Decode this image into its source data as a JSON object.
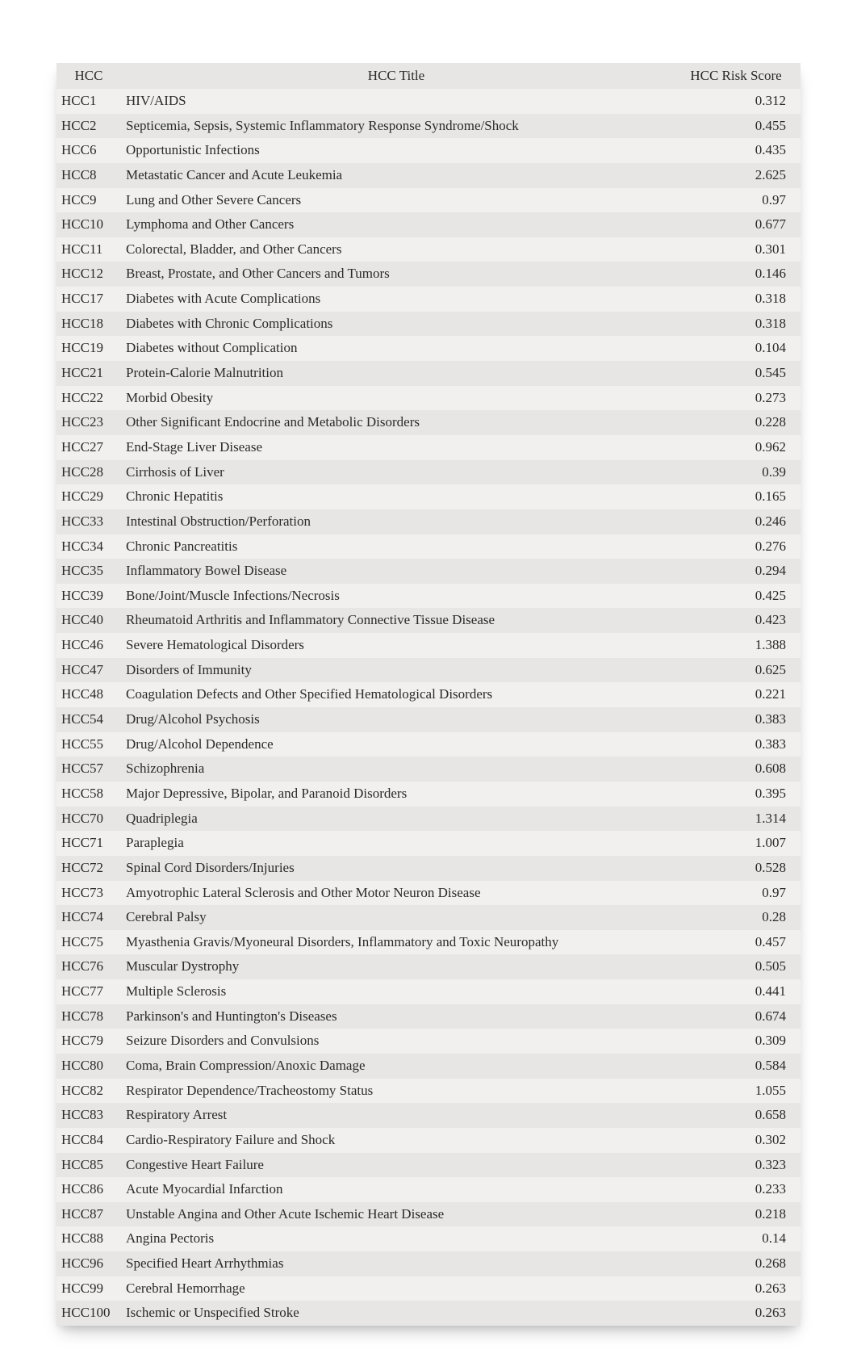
{
  "headers": {
    "hcc": "HCC",
    "title": "HCC Title",
    "score": "HCC Risk Score"
  },
  "rows": [
    {
      "hcc": "HCC1",
      "title": "HIV/AIDS",
      "score": "0.312"
    },
    {
      "hcc": "HCC2",
      "title": "Septicemia, Sepsis, Systemic Inflammatory Response Syndrome/Shock",
      "score": "0.455"
    },
    {
      "hcc": "HCC6",
      "title": "Opportunistic Infections",
      "score": "0.435"
    },
    {
      "hcc": "HCC8",
      "title": "Metastatic Cancer and Acute Leukemia",
      "score": "2.625"
    },
    {
      "hcc": "HCC9",
      "title": "Lung and Other Severe Cancers",
      "score": "0.97"
    },
    {
      "hcc": "HCC10",
      "title": "Lymphoma and Other Cancers",
      "score": "0.677"
    },
    {
      "hcc": "HCC11",
      "title": "Colorectal, Bladder, and Other Cancers",
      "score": "0.301"
    },
    {
      "hcc": "HCC12",
      "title": "Breast, Prostate, and Other Cancers and Tumors",
      "score": "0.146"
    },
    {
      "hcc": "HCC17",
      "title": "Diabetes with Acute Complications",
      "score": "0.318"
    },
    {
      "hcc": "HCC18",
      "title": "Diabetes with Chronic Complications",
      "score": "0.318"
    },
    {
      "hcc": "HCC19",
      "title": "Diabetes without Complication",
      "score": "0.104"
    },
    {
      "hcc": "HCC21",
      "title": "Protein-Calorie Malnutrition",
      "score": "0.545"
    },
    {
      "hcc": "HCC22",
      "title": "Morbid Obesity",
      "score": "0.273"
    },
    {
      "hcc": "HCC23",
      "title": "Other Significant Endocrine and Metabolic Disorders",
      "score": "0.228"
    },
    {
      "hcc": "HCC27",
      "title": "End-Stage Liver Disease",
      "score": "0.962"
    },
    {
      "hcc": "HCC28",
      "title": "Cirrhosis of Liver",
      "score": "0.39"
    },
    {
      "hcc": "HCC29",
      "title": "Chronic Hepatitis",
      "score": "0.165"
    },
    {
      "hcc": "HCC33",
      "title": "Intestinal Obstruction/Perforation",
      "score": "0.246"
    },
    {
      "hcc": "HCC34",
      "title": "Chronic Pancreatitis",
      "score": "0.276"
    },
    {
      "hcc": "HCC35",
      "title": "Inflammatory Bowel Disease",
      "score": "0.294"
    },
    {
      "hcc": "HCC39",
      "title": "Bone/Joint/Muscle Infections/Necrosis",
      "score": "0.425"
    },
    {
      "hcc": "HCC40",
      "title": "Rheumatoid Arthritis and Inflammatory Connective Tissue Disease",
      "score": "0.423"
    },
    {
      "hcc": "HCC46",
      "title": "Severe Hematological Disorders",
      "score": "1.388"
    },
    {
      "hcc": "HCC47",
      "title": "Disorders of Immunity",
      "score": "0.625"
    },
    {
      "hcc": "HCC48",
      "title": "Coagulation Defects and Other Specified Hematological Disorders",
      "score": "0.221"
    },
    {
      "hcc": "HCC54",
      "title": "Drug/Alcohol Psychosis",
      "score": "0.383"
    },
    {
      "hcc": "HCC55",
      "title": "Drug/Alcohol Dependence",
      "score": "0.383"
    },
    {
      "hcc": "HCC57",
      "title": "Schizophrenia",
      "score": "0.608"
    },
    {
      "hcc": "HCC58",
      "title": "Major Depressive, Bipolar, and Paranoid Disorders",
      "score": "0.395"
    },
    {
      "hcc": "HCC70",
      "title": "Quadriplegia",
      "score": "1.314"
    },
    {
      "hcc": "HCC71",
      "title": "Paraplegia",
      "score": "1.007"
    },
    {
      "hcc": "HCC72",
      "title": "Spinal Cord Disorders/Injuries",
      "score": "0.528"
    },
    {
      "hcc": "HCC73",
      "title": "Amyotrophic Lateral Sclerosis and Other Motor Neuron Disease",
      "score": "0.97"
    },
    {
      "hcc": "HCC74",
      "title": "Cerebral Palsy",
      "score": "0.28"
    },
    {
      "hcc": "HCC75",
      "title": "Myasthenia Gravis/Myoneural Disorders,  Inflammatory and Toxic Neuropathy",
      "score": "0.457"
    },
    {
      "hcc": "HCC76",
      "title": "Muscular Dystrophy",
      "score": "0.505"
    },
    {
      "hcc": "HCC77",
      "title": "Multiple Sclerosis",
      "score": "0.441"
    },
    {
      "hcc": "HCC78",
      "title": "Parkinson's and Huntington's Diseases",
      "score": "0.674"
    },
    {
      "hcc": "HCC79",
      "title": "Seizure Disorders and Convulsions",
      "score": "0.309"
    },
    {
      "hcc": "HCC80",
      "title": "Coma, Brain Compression/Anoxic Damage",
      "score": "0.584"
    },
    {
      "hcc": "HCC82",
      "title": "Respirator Dependence/Tracheostomy Status",
      "score": "1.055"
    },
    {
      "hcc": "HCC83",
      "title": "Respiratory Arrest",
      "score": "0.658"
    },
    {
      "hcc": "HCC84",
      "title": "Cardio-Respiratory Failure and Shock",
      "score": "0.302"
    },
    {
      "hcc": "HCC85",
      "title": "Congestive Heart Failure",
      "score": "0.323"
    },
    {
      "hcc": "HCC86",
      "title": "Acute Myocardial Infarction",
      "score": "0.233"
    },
    {
      "hcc": "HCC87",
      "title": "Unstable Angina and Other Acute Ischemic Heart Disease",
      "score": "0.218"
    },
    {
      "hcc": "HCC88",
      "title": "Angina Pectoris",
      "score": "0.14"
    },
    {
      "hcc": "HCC96",
      "title": "Specified Heart Arrhythmias",
      "score": "0.268"
    },
    {
      "hcc": "HCC99",
      "title": "Cerebral Hemorrhage",
      "score": "0.263"
    },
    {
      "hcc": "HCC100",
      "title": "Ischemic or Unspecified Stroke",
      "score": "0.263"
    }
  ]
}
